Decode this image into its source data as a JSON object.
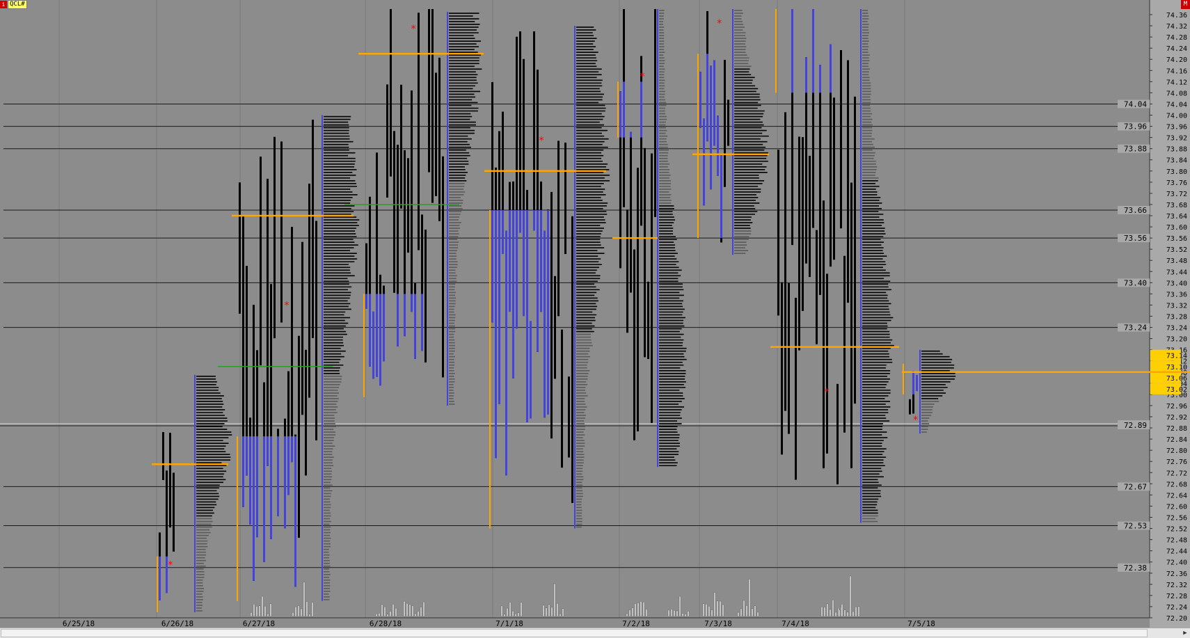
{
  "app": {
    "symbol": "QCL#",
    "logo_label": "i",
    "menu_button": "M"
  },
  "chart_data": {
    "type": "market-profile",
    "title": "",
    "xlabel": "",
    "ylabel": "",
    "ylim": [
      72.2,
      74.38
    ],
    "y_tick_step": 0.04,
    "dates": [
      "6/25/18",
      "6/26/18",
      "6/27/18",
      "6/28/18",
      "7/1/18",
      "7/2/18",
      "7/3/18",
      "7/4/18",
      "7/5/18"
    ],
    "reference_levels": [
      "74.04",
      "73.96",
      "73.88",
      "73.66",
      "73.56",
      "73.40",
      "73.24",
      "72.67",
      "72.53",
      "72.38"
    ],
    "current_price": "72.89",
    "highlighted_levels": [
      "73.14",
      "73.10",
      "73.06",
      "73.02"
    ],
    "sessions": [
      {
        "date": "6/26/18",
        "tpo_low": 72.22,
        "tpo_high": 73.07,
        "ib_low": 72.22,
        "ib_high": 72.42,
        "poc": 72.75,
        "vol_low": 72.22,
        "vol_high": 73.07,
        "vol_peak": 72.84,
        "open_marker": 72.39
      },
      {
        "date": "6/27/18",
        "tpo_low": 72.22,
        "tpo_high": 74.03,
        "ib_low": 72.26,
        "ib_high": 72.85,
        "poc": 73.64,
        "vol_low": 72.26,
        "vol_high": 74.0,
        "vol_peak": 73.64,
        "open_marker": 73.32,
        "mid_line": 73.1
      },
      {
        "date": "6/28/18",
        "tpo_low": 72.96,
        "tpo_high": 74.38,
        "ib_low": 72.99,
        "ib_high": 73.36,
        "poc": 74.22,
        "vol_low": 72.96,
        "vol_high": 74.37,
        "vol_peak": 74.22,
        "open_marker": 74.31,
        "mid_line": 73.68
      },
      {
        "date": "7/1/18",
        "tpo_low": 72.52,
        "tpo_high": 74.3,
        "ib_low": 72.52,
        "ib_high": 73.66,
        "poc": 73.8,
        "vol_low": 72.52,
        "vol_high": 74.32,
        "vol_peak": 73.8,
        "open_marker": 73.91
      },
      {
        "date": "7/2/18",
        "tpo_low": 72.74,
        "tpo_high": 74.38,
        "ib_low": 73.92,
        "ib_high": 74.12,
        "poc": 73.56,
        "vol_low": 72.74,
        "vol_high": 74.38,
        "vol_peak": 73.15,
        "open_marker": 74.14
      },
      {
        "date": "7/3/18",
        "tpo_low": 73.5,
        "tpo_high": 74.38,
        "ib_low": 73.56,
        "ib_high": 74.22,
        "poc": 73.86,
        "vol_low": 73.5,
        "vol_high": 74.38,
        "vol_peak": 73.88,
        "open_marker": 74.33
      },
      {
        "date": "7/4/18",
        "tpo_low": 72.54,
        "tpo_high": 74.38,
        "ib_low": 74.08,
        "ib_high": 74.38,
        "poc": 73.17,
        "vol_low": 72.54,
        "vol_high": 74.38,
        "vol_peak": 73.17,
        "open_marker": 73.01
      },
      {
        "date": "7/5/18",
        "tpo_low": 72.86,
        "tpo_high": 73.17,
        "ib_low": 73.0,
        "ib_high": 73.11,
        "poc": 73.08,
        "vol_low": 72.86,
        "vol_high": 73.16,
        "vol_peak": 73.08,
        "open_marker": 72.91
      }
    ]
  },
  "colors": {
    "background": "#8c8c8c",
    "grid": "#7a7a7a",
    "tpo": "#000000",
    "initial_balance": "#4444dd",
    "poc": "#ffa500",
    "value_area": "#dd3333",
    "open_marker": "#ff0000",
    "volume_profile": "#000000",
    "volume_profile_outside": "#5a5a5a",
    "highlight": "#ffd000"
  }
}
